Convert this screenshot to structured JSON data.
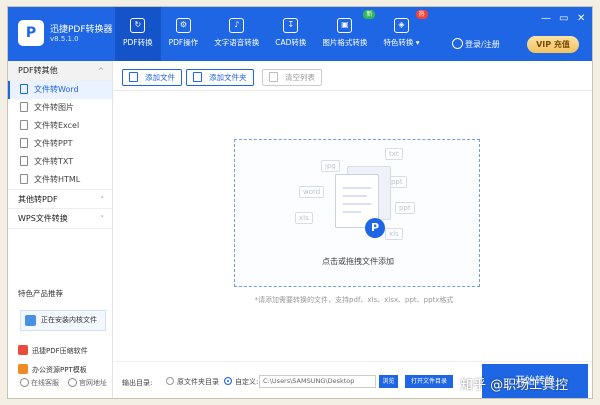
{
  "app": {
    "logo_letter": "P",
    "name": "迅捷PDF转换器",
    "version": "v8.5.1.0"
  },
  "nav": [
    {
      "label": "PDF转换",
      "icon": "↻",
      "active": true
    },
    {
      "label": "PDF操作",
      "icon": "⚙"
    },
    {
      "label": "文字语音转换",
      "icon": "♪"
    },
    {
      "label": "CAD转换",
      "icon": "↧"
    },
    {
      "label": "图片格式转换",
      "icon": "▣",
      "badge": "新"
    },
    {
      "label": "特色转换 ▾",
      "icon": "◈",
      "badge": "热"
    }
  ],
  "header": {
    "login": "登录/注册",
    "vip": "VIP 充值",
    "minimize": "—",
    "restore": "▭",
    "close": "✕"
  },
  "sidebar": {
    "sections": [
      {
        "label": "PDF转其他",
        "chev": "^"
      },
      {
        "label": "其他转PDF",
        "chev": "˅"
      },
      {
        "label": "WPS文件转换",
        "chev": "˅"
      }
    ],
    "items": [
      {
        "label": "文件转Word"
      },
      {
        "label": "文件转图片"
      },
      {
        "label": "文件转Excel"
      },
      {
        "label": "文件转PPT"
      },
      {
        "label": "文件转TXT"
      },
      {
        "label": "文件转HTML"
      }
    ],
    "promo_title": "特色产品推荐",
    "promo_box": "正在安装内核文件",
    "products": [
      "迅捷PDF压缩软件",
      "办公资源PPT模板"
    ],
    "links": [
      "在线客服",
      "官网地址"
    ]
  },
  "toolbar": {
    "add_file": "添加文件",
    "add_folder": "添加文件夹",
    "clear_list": "清空列表"
  },
  "dropzone": {
    "text": "点击或拖拽文件添加",
    "ghosts": [
      "jpg",
      "txt",
      "word",
      "xls",
      "ppt",
      "ppt",
      "xls"
    ],
    "logo": "P"
  },
  "hint": "*请添加需要转换的文件，支持pdf、xls、xlsx、ppt、pptx格式",
  "output": {
    "label": "输出目录:",
    "option_source": "原文件夹目录",
    "option_custom": "自定义:",
    "path": "C:\\Users\\SAMSUNG\\Desktop",
    "browse": "浏览",
    "open_dir": "打开文件目录",
    "start": "开始转换"
  },
  "watermark": "知乎 @职场工具控",
  "colors": {
    "brand": "#1e66e4",
    "new_badge": "#2fb855",
    "hot_badge": "#f0443a"
  }
}
